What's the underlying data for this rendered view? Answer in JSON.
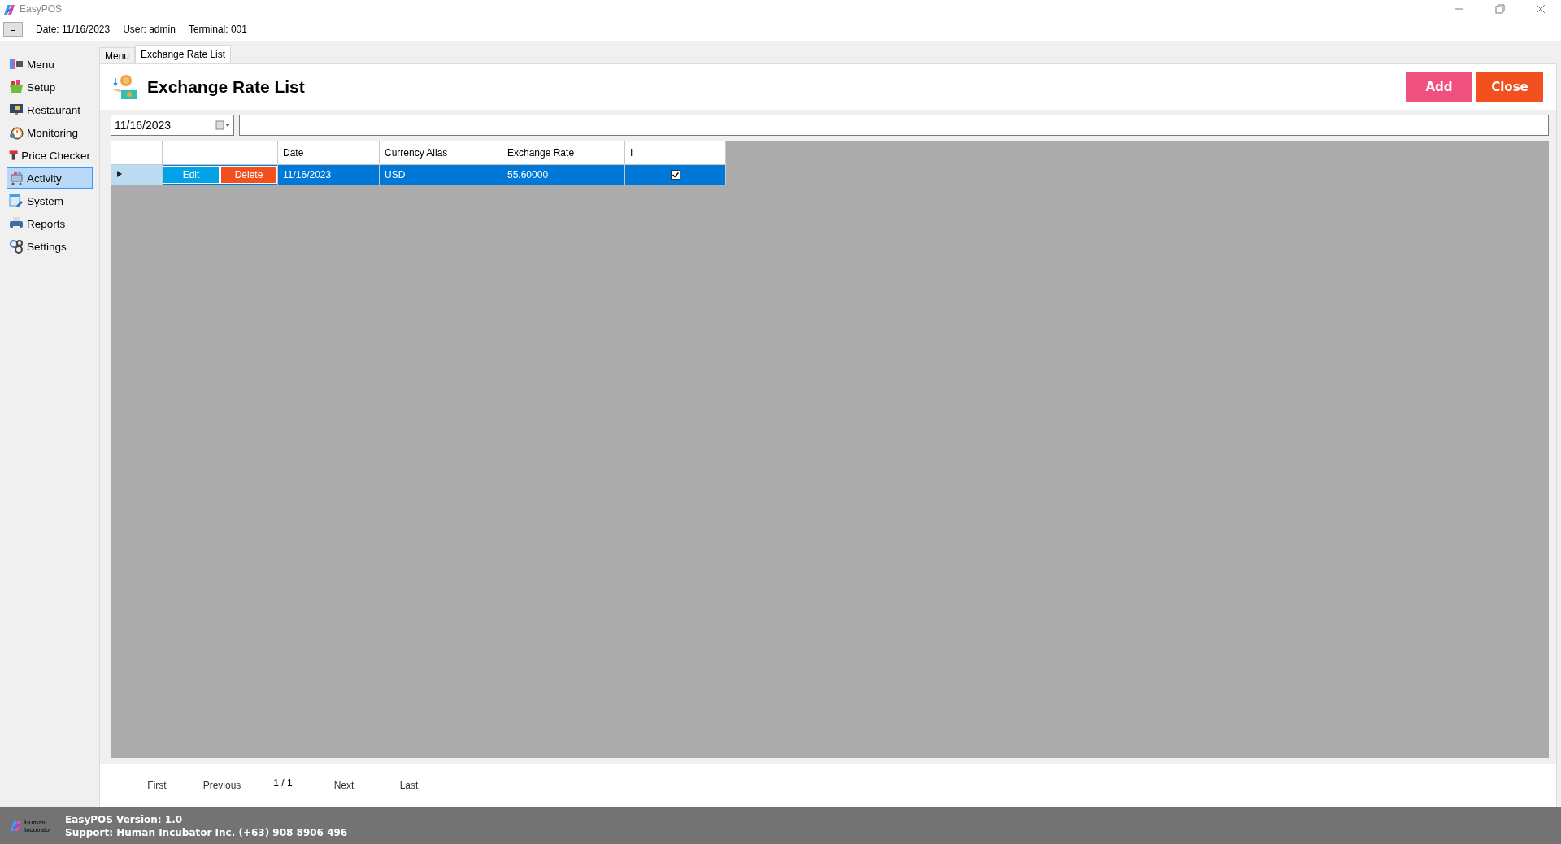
{
  "window": {
    "title": "EasyPOS"
  },
  "info_bar": {
    "menu_button": "=",
    "date": "Date: 11/16/2023",
    "user": "User: admin",
    "terminal": "Terminal: 001"
  },
  "sidebar": {
    "items": [
      {
        "label": "Menu",
        "selected": false
      },
      {
        "label": "Setup",
        "selected": false
      },
      {
        "label": "Restaurant",
        "selected": false
      },
      {
        "label": "Monitoring",
        "selected": false
      },
      {
        "label": "Price Checker",
        "selected": false
      },
      {
        "label": "Activity",
        "selected": true
      },
      {
        "label": "System",
        "selected": false
      },
      {
        "label": "Reports",
        "selected": false
      },
      {
        "label": "Settings",
        "selected": false
      }
    ]
  },
  "tabs": [
    {
      "label": "Menu",
      "selected": false
    },
    {
      "label": "Exchange Rate List",
      "selected": true
    }
  ],
  "page": {
    "title": "Exchange Rate List",
    "buttons": [
      {
        "label": "Add",
        "color": "#f0507f"
      },
      {
        "label": "Close",
        "color": "#f2501e"
      }
    ]
  },
  "filter": {
    "date": "11/16/2023"
  },
  "table": {
    "columns": [
      "Date",
      "Currency Alias",
      "Exchange Rate",
      "I"
    ],
    "rows": [
      {
        "selected": true,
        "edit": "Edit",
        "delete": "Delete",
        "cells": [
          "11/16/2023",
          "USD",
          "55.60000"
        ],
        "checked": true
      }
    ]
  },
  "pager": {
    "first": "First",
    "previous": "Previous",
    "page": "1 / 1",
    "next": "Next",
    "last": "Last"
  },
  "footer": {
    "logo_text": "Human Incubator",
    "version": "EasyPOS Version: 1.0",
    "support": "Support: Human Incubator Inc. (+63) 908 8906 496"
  }
}
